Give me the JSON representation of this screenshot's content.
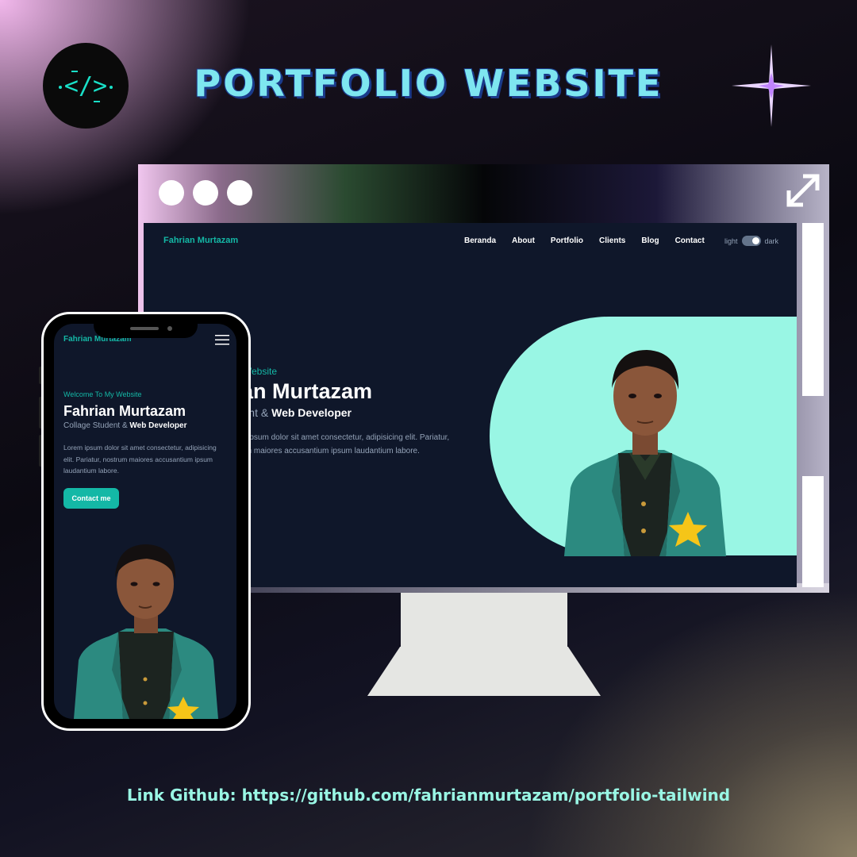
{
  "banner": {
    "title": "PORTFOLIO WEBSITE",
    "footer": "Link Github: https://github.com/fahrianmurtazam/portfolio-tailwind"
  },
  "logo": {
    "icon": "code-brackets-icon",
    "text": "</>"
  },
  "desktop": {
    "brand": "Fahrian Murtazam",
    "nav": [
      "Beranda",
      "About",
      "Portfolio",
      "Clients",
      "Blog",
      "Contact"
    ],
    "toggle": {
      "light": "light",
      "dark": "dark",
      "state": "dark"
    },
    "hero": {
      "welcome": "Welcome To My Website",
      "name": "Fahrian Murtazam",
      "role_prefix": "Collage Student &",
      "role_strong": "Web Developer",
      "description": "Lorem ipsum dolor sit amet consectetur, adipisicing elit. Pariatur, nostrum maiores accusantium ipsum laudantium labore."
    }
  },
  "mobile": {
    "brand": "Fahrian Murtazam",
    "menu_icon": "hamburger-icon",
    "hero": {
      "welcome": "Welcome To My Website",
      "name": "Fahrian Murtazam",
      "role_prefix": "Collage Student &",
      "role_strong": "Web Developer",
      "description": "Lorem ipsum dolor sit amet consectetur, adipisicing elit. Pariatur, nostrum maiores accusantium ipsum laudantium labore.",
      "cta": "Contact me"
    }
  },
  "colors": {
    "accent": "#14b8a6",
    "accent_light": "#99f6e4",
    "screen_bg": "#0f172a",
    "title": "#7ee6f0"
  }
}
